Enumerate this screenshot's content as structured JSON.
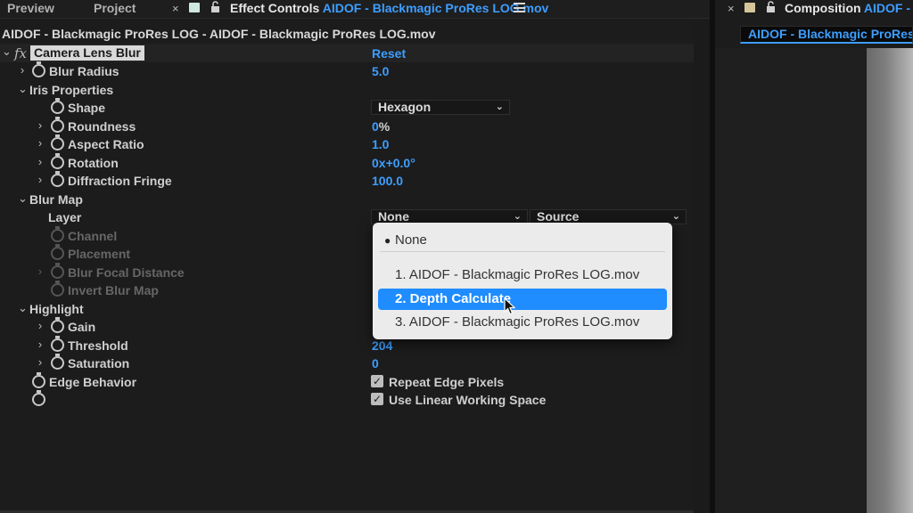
{
  "tabs": [
    {
      "label": "Preview"
    },
    {
      "label": "Project"
    },
    {
      "label": "Effect Controls",
      "accent": "AIDOF - Blackmagic ProRes LOG.mov"
    }
  ],
  "right_tab": {
    "label": "Composition",
    "accent": "AIDOF - Bla",
    "chip": "AIDOF - Blackmagic ProRes"
  },
  "close_glyph": "×",
  "layer_title": "AIDOF - Blackmagic ProRes LOG - AIDOF - Blackmagic ProRes LOG.mov",
  "effect": {
    "fx": "fx",
    "name": "Camera Lens Blur",
    "reset": "Reset"
  },
  "props": {
    "blur_radius": {
      "label": "Blur Radius",
      "value": "5.0"
    },
    "iris_properties": {
      "label": "Iris Properties"
    },
    "shape": {
      "label": "Shape",
      "value": "Hexagon"
    },
    "roundness": {
      "label": "Roundness",
      "value": "0",
      "unit": "%"
    },
    "aspect_ratio": {
      "label": "Aspect Ratio",
      "value": "1.0"
    },
    "rotation": {
      "label": "Rotation",
      "value": "0x+0.0°"
    },
    "diffraction_fringe": {
      "label": "Diffraction Fringe",
      "value": "100.0"
    },
    "blur_map": {
      "label": "Blur Map"
    },
    "layer": {
      "label": "Layer",
      "value": "None",
      "source": "Source"
    },
    "channel": {
      "label": "Channel"
    },
    "placement": {
      "label": "Placement"
    },
    "blur_focal_distance": {
      "label": "Blur Focal Distance"
    },
    "invert_blur_map": {
      "label": "Invert Blur Map"
    },
    "highlight": {
      "label": "Highlight"
    },
    "gain": {
      "label": "Gain"
    },
    "threshold": {
      "label": "Threshold",
      "value": "204"
    },
    "saturation": {
      "label": "Saturation",
      "value": "0"
    },
    "edge_behavior": {
      "label": "Edge Behavior",
      "checkbox": "Repeat Edge Pixels",
      "checked": true
    },
    "linear": {
      "checkbox": "Use Linear Working Space",
      "checked": true
    }
  },
  "popup": {
    "items": [
      {
        "label": "None",
        "current": true
      },
      {
        "label": "1. AIDOF - Blackmagic ProRes LOG.mov"
      },
      {
        "label": "2. Depth Calculate",
        "selected": true
      },
      {
        "label": "3. AIDOF - Blackmagic ProRes LOG.mov"
      }
    ]
  },
  "colors": {
    "accent": "#3d9eff",
    "selection": "#1f8cff",
    "panel": "#1c1c1c",
    "menu": "#ebebeb"
  },
  "icons": {
    "stopwatch": "stopwatch-icon",
    "twirl": "chevron-right-icon",
    "lock": "lock-icon",
    "menu": "hamburger-menu-icon"
  }
}
